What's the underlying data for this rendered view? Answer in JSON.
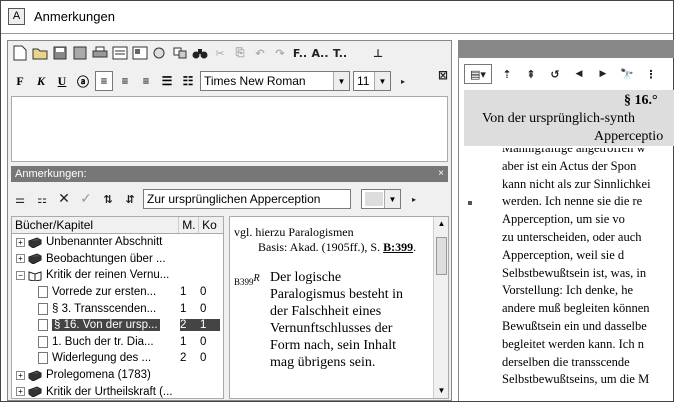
{
  "window": {
    "title": "Anmerkungen",
    "app_icon_letter": "A"
  },
  "toolbar2": {
    "bold": "F",
    "italic": "K",
    "underline": "U",
    "font": "Times New Roman",
    "size": "11"
  },
  "toolbar1_text": {
    "f_label": "F..",
    "a_label": "A..",
    "t_label": "T.."
  },
  "annotations_header": {
    "label": "Anmerkungen:",
    "close": "×"
  },
  "search": {
    "value": "Zur ursprünglichen Apperception"
  },
  "tree": {
    "headers": [
      "Bücher/Kapitel",
      "M.",
      "Ko"
    ],
    "rows": [
      {
        "label": "Unbenannter Abschnitt",
        "m": "",
        "ko": "",
        "level": 0,
        "expander": "+",
        "icon": "book-icon"
      },
      {
        "label": "Beobachtungen über ...",
        "m": "",
        "ko": "",
        "level": 0,
        "expander": "+",
        "icon": "book-icon"
      },
      {
        "label": "Kritik der reinen Vernu...",
        "m": "",
        "ko": "",
        "level": 0,
        "expander": "−",
        "icon": "open-book-icon"
      },
      {
        "label": "Vorrede zur ersten...",
        "m": "1",
        "ko": "0",
        "level": 1,
        "icon": "document-icon"
      },
      {
        "label": "§ 3. Transscenden...",
        "m": "1",
        "ko": "0",
        "level": 1,
        "icon": "document-icon"
      },
      {
        "label": "§ 16. Von der ursp...",
        "m": "2",
        "ko": "1",
        "level": 1,
        "icon": "document-icon",
        "selected": true
      },
      {
        "label": "1. Buch der tr. Dia...",
        "m": "1",
        "ko": "0",
        "level": 1,
        "icon": "document-icon"
      },
      {
        "label": "Widerlegung des ...",
        "m": "2",
        "ko": "0",
        "level": 1,
        "icon": "document-icon"
      },
      {
        "label": "Prolegomena (1783)",
        "m": "",
        "ko": "",
        "level": 0,
        "expander": "+",
        "icon": "book-icon"
      },
      {
        "label": "Kritik der Urtheilskraft (...",
        "m": "",
        "ko": "",
        "level": 0,
        "expander": "+",
        "icon": "book-icon"
      }
    ]
  },
  "note": {
    "line1": "vgl. hierzu Paralogismen",
    "basis_line": "Basis: Akad. (1905ff.), S.",
    "basis_ref": "B:399",
    "basis_end": ".",
    "marker": "B399",
    "marker_sup": "R",
    "body": [
      "Der logische",
      "Paralogismus besteht in",
      "der Falschheit eines",
      "Vernunftschlusses der",
      "Form nach, sein Inhalt",
      "mag übrigens sein."
    ]
  },
  "reader": {
    "section": "§ 16.°",
    "title_line1": "Von der ursprünglich-synth",
    "title_line2": "Apperceptio",
    "lines": [
      "Mannigfaltige angetroffen w",
      "aber ist ein Actus der Spon",
      "kann nicht als zur Sinnlichkei",
      "werden. Ich nenne sie die re",
      "Apperception, um sie vo",
      "zu unterscheiden, oder auch",
      "Apperception, weil sie d",
      "Selbstbewußtsein ist, was, in",
      "Vorstellung: Ich denke, he",
      "andere muß begleiten können",
      "Bewußtsein ein und dasselbe",
      "begleitet werden kann. Ich n",
      "derselben die transscende",
      "Selbstbewußtseins, um die M"
    ]
  },
  "colors": {
    "selection": "#444444",
    "header": "#777777",
    "highlight": "#dddddd"
  }
}
